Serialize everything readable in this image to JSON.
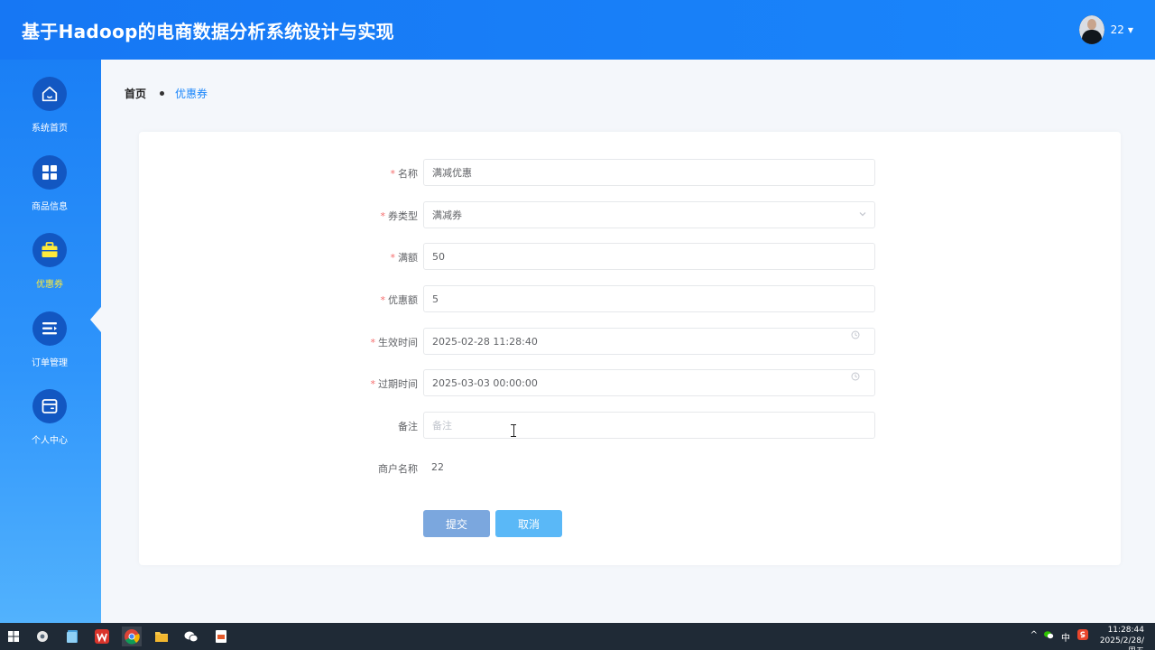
{
  "header": {
    "app_title": "基于Hadoop的电商数据分析系统设计与实现",
    "user_name": "22",
    "caret": "▼"
  },
  "sidebar": {
    "items": [
      {
        "label": "系统首页",
        "icon": "home-icon"
      },
      {
        "label": "商品信息",
        "icon": "grid-icon"
      },
      {
        "label": "优惠券",
        "icon": "briefcase-icon",
        "active": true
      },
      {
        "label": "订单管理",
        "icon": "list-icon"
      },
      {
        "label": "个人中心",
        "icon": "window-icon"
      }
    ],
    "active_label_color": "#ffeb3b"
  },
  "breadcrumb": {
    "home": "首页",
    "current": "优惠券"
  },
  "form": {
    "name": {
      "label": "名称",
      "value": "满减优惠",
      "required": true
    },
    "coupon_type": {
      "label": "券类型",
      "value": "满减券",
      "required": true
    },
    "threshold": {
      "label": "满额",
      "value": "50",
      "required": true
    },
    "discount": {
      "label": "优惠额",
      "value": "5",
      "required": true
    },
    "start_time": {
      "label": "生效时间",
      "value": "2025-02-28 11:28:40",
      "required": true
    },
    "end_time": {
      "label": "过期时间",
      "value": "2025-03-03 00:00:00",
      "required": true
    },
    "remark": {
      "label": "备注",
      "value": "",
      "placeholder": "备注",
      "required": false
    },
    "merchant_name": {
      "label": "商户名称",
      "value": "22"
    },
    "required_mark": "*"
  },
  "buttons": {
    "submit": "提交",
    "cancel": "取消"
  },
  "taskbar": {
    "tray_ime": "中",
    "tray_up": "^",
    "time": "11:28:44",
    "date": "2025/2/28/周五"
  },
  "colors": {
    "header_bg": "#1677f4",
    "accent": "#1a86fb",
    "required": "#f56c6c",
    "submit_bg": "#7ba7de",
    "cancel_bg": "#5ab8f7"
  }
}
